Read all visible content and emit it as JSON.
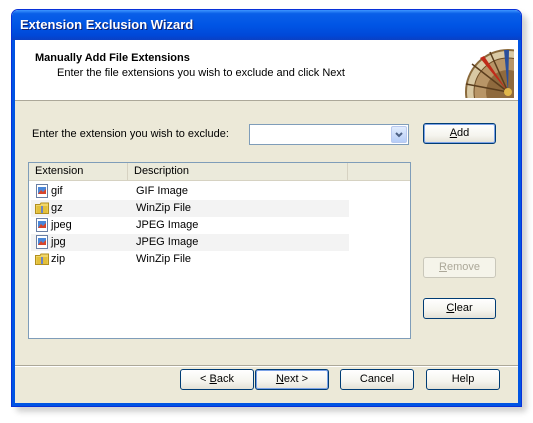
{
  "window": {
    "title": "Extension Exclusion Wizard"
  },
  "header": {
    "title": "Manually Add File Extensions",
    "subtitle": "Enter the file extensions you wish to exclude and click Next"
  },
  "form": {
    "extension_label": "Enter the extension you wish to exclude:",
    "extension_value": ""
  },
  "buttons": {
    "add": {
      "pre": "",
      "mn": "A",
      "post": "dd"
    },
    "remove": {
      "pre": "",
      "mn": "R",
      "post": "emove"
    },
    "clear": {
      "pre": "",
      "mn": "C",
      "post": "lear"
    },
    "back": {
      "pre": "< ",
      "mn": "B",
      "post": "ack"
    },
    "next": {
      "pre": "",
      "mn": "N",
      "post": "ext >"
    },
    "cancel": "Cancel",
    "help": "Help"
  },
  "list": {
    "columns": [
      "Extension",
      "Description"
    ],
    "rows": [
      {
        "ext": "gif",
        "desc": "GIF Image",
        "icon": "image-file-icon"
      },
      {
        "ext": "gz",
        "desc": "WinZip File",
        "icon": "zip-folder-icon"
      },
      {
        "ext": "jpeg",
        "desc": "JPEG Image",
        "icon": "image-file-icon"
      },
      {
        "ext": "jpg",
        "desc": "JPEG Image",
        "icon": "image-file-icon"
      },
      {
        "ext": "zip",
        "desc": "WinZip File",
        "icon": "zip-folder-icon"
      }
    ]
  },
  "colors": {
    "titlebar": "#0055e5",
    "dialog_bg": "#ece9d8",
    "border": "#7f9db9"
  }
}
